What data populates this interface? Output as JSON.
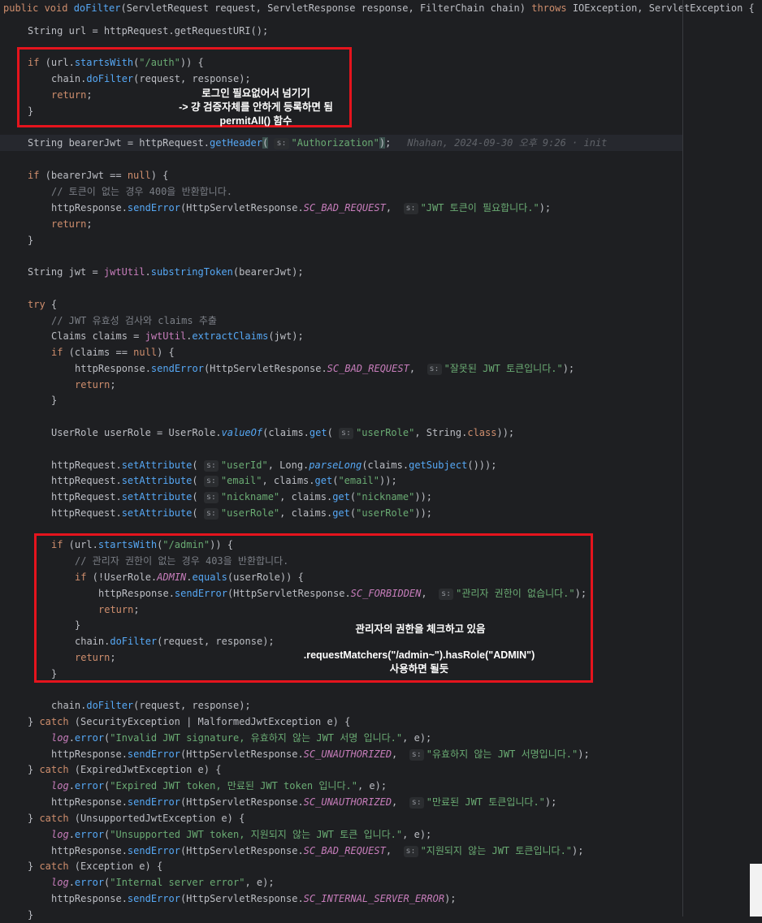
{
  "code": {
    "header": {
      "p1": "public void ",
      "fn": "doFilter",
      "p2": "(ServletRequest request, ServletResponse response, FilterChain chain) ",
      "kw": "throws",
      "p3": " IOException, ServletException {"
    },
    "url_line": "String url = httpRequest.getRequestURI();",
    "auth_if": "\"/auth\"",
    "dofilter_call": "doFilter",
    "bearer_blame": "Nhahan, 2024-09-30 오후 9:26 · init",
    "auth_header": "\"Authorization\"",
    "cmt_no_token": "// 토큰이 없는 경우 400을 반환합니다.",
    "msg_need_jwt": "\"JWT 토큰이 필요합니다.\"",
    "cmt_validate": "// JWT 유효성 검사와 claims 추출",
    "msg_wrong_jwt": "\"잘못된 JWT 토큰입니다.\"",
    "attr_userid": "\"userId\"",
    "attr_email": "\"email\"",
    "attr_nickname": "\"nickname\"",
    "attr_userrole": "\"userRole\"",
    "admin_path": "\"/admin\"",
    "cmt_admin": "// 관리자 권한이 없는 경우 403을 반환합니다.",
    "msg_no_admin": "\"관리자 권한이 없습니다.\"",
    "log_invalid": "\"Invalid JWT signature, 유효하지 않는 JWT 서명 입니다.\"",
    "msg_invalid": "\"유효하지 않는 JWT 서명입니다.\"",
    "log_expired": "\"Expired JWT token, 만료된 JWT token 입니다.\"",
    "msg_expired": "\"만료된 JWT 토큰입니다.\"",
    "log_unsupported": "\"Unsupported JWT token, 지원되지 않는 JWT 토큰 입니다.\"",
    "msg_unsupported": "\"지원되지 않는 JWT 토큰입니다.\"",
    "log_internal": "\"Internal server error\"",
    "hint_s": "s:"
  },
  "annotations": {
    "auth_note": {
      "line1": "로그인 필요없어서 넘기기",
      "line2": "-> 걍 검증자체를 안하게 등록하면 됨",
      "line3": "permitAll()  함수"
    },
    "admin_note": {
      "line1": "관리자의 권한을 체크하고 있음",
      "line2": ".requestMatchers(\"/admin~\").hasRole(\"ADMIN\")",
      "line3": "사용하면 될듯"
    }
  },
  "colors": {
    "background": "#1e1f22",
    "keyword": "#cf8e6d",
    "string": "#6aab73",
    "method": "#56a8f5",
    "comment": "#7a7e85",
    "field": "#c77dbb",
    "annotation_box": "#e5141d"
  }
}
